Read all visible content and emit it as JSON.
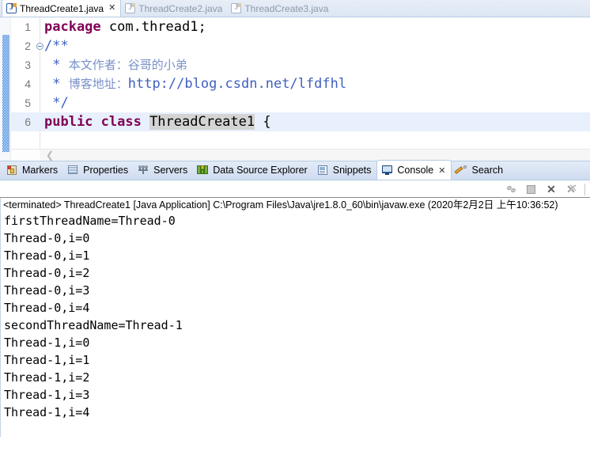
{
  "editor_tabs": [
    {
      "label": "ThreadCreate1.java",
      "icon": "java-file-icon",
      "active": true,
      "closable": true
    },
    {
      "label": "ThreadCreate2.java",
      "icon": "java-file-icon",
      "active": false,
      "closable": false
    },
    {
      "label": "ThreadCreate3.java",
      "icon": "java-file-icon",
      "active": false,
      "closable": false
    }
  ],
  "close_glyph": "✕",
  "code": {
    "lines": [
      {
        "num": "1",
        "fold": "",
        "highlight": false,
        "segments": [
          {
            "text": "package",
            "style": "kw"
          },
          {
            "text": " com.thread1;",
            "style": "plain"
          }
        ]
      },
      {
        "num": "2",
        "fold": "collapse",
        "highlight": false,
        "segments": [
          {
            "text": "/**",
            "style": "cmt"
          }
        ]
      },
      {
        "num": "3",
        "fold": "",
        "highlight": false,
        "segments": [
          {
            "text": " * ",
            "style": "cmt"
          },
          {
            "text": "本文作者：谷哥的小弟",
            "style": "cmt-cn"
          }
        ]
      },
      {
        "num": "4",
        "fold": "",
        "highlight": false,
        "segments": [
          {
            "text": " * ",
            "style": "cmt"
          },
          {
            "text": "博客地址：",
            "style": "cmt-cn"
          },
          {
            "text": "http://blog.csdn.net/lfdfhl",
            "style": "cmt-url"
          }
        ]
      },
      {
        "num": "5",
        "fold": "",
        "highlight": false,
        "segments": [
          {
            "text": " */",
            "style": "cmt"
          }
        ]
      },
      {
        "num": "6",
        "fold": "",
        "highlight": true,
        "segments": [
          {
            "text": "public class ",
            "style": "kw"
          },
          {
            "text": "ThreadCreate1",
            "style": "occ"
          },
          {
            "text": " {",
            "style": "plain"
          }
        ]
      }
    ]
  },
  "editor_scroll": {
    "left_arrow": "❮"
  },
  "view_tabs": [
    {
      "label": "Markers",
      "icon": "markers-icon",
      "active": false,
      "closable": false
    },
    {
      "label": "Properties",
      "icon": "properties-icon",
      "active": false,
      "closable": false
    },
    {
      "label": "Servers",
      "icon": "servers-icon",
      "active": false,
      "closable": false
    },
    {
      "label": "Data Source Explorer",
      "icon": "data-source-explorer-icon",
      "active": false,
      "closable": false
    },
    {
      "label": "Snippets",
      "icon": "snippets-icon",
      "active": false,
      "closable": false
    },
    {
      "label": "Console",
      "icon": "console-icon",
      "active": true,
      "closable": true
    },
    {
      "label": "Search",
      "icon": "search-icon",
      "active": false,
      "closable": false
    }
  ],
  "console_toolbar": {
    "icons": [
      {
        "name": "pin-console-icon",
        "glyph": ""
      },
      {
        "name": "terminate-icon",
        "glyph": ""
      },
      {
        "name": "remove-launch-icon",
        "glyph": "✕"
      },
      {
        "name": "remove-all-terminated-icon",
        "glyph": "✕"
      }
    ]
  },
  "console": {
    "terminated_line": "<terminated> ThreadCreate1 [Java Application] C:\\Program Files\\Java\\jre1.8.0_60\\bin\\javaw.exe (2020年2月2日 上午10:36:52)",
    "output": [
      "firstThreadName=Thread-0",
      "Thread-0,i=0",
      "Thread-0,i=1",
      "Thread-0,i=2",
      "Thread-0,i=3",
      "Thread-0,i=4",
      "secondThreadName=Thread-1",
      "Thread-1,i=0",
      "Thread-1,i=1",
      "Thread-1,i=2",
      "Thread-1,i=3",
      "Thread-1,i=4"
    ]
  },
  "colors": {
    "keyword": "#7f0055",
    "comment": "#3f5fbf",
    "tab_active_bg": "#ffffff",
    "current_line": "#e8f0fd",
    "occurrence": "#d4d4d4"
  }
}
